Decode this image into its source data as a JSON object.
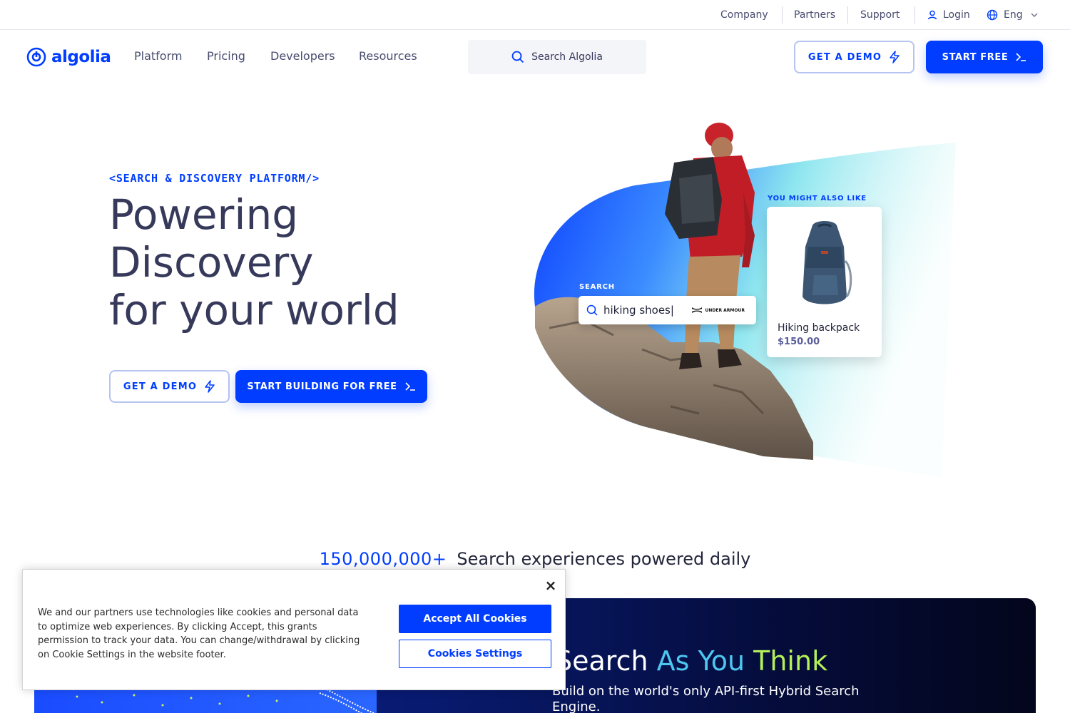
{
  "utility": {
    "company": "Company",
    "partners": "Partners",
    "support": "Support",
    "login": "Login",
    "language": "Eng"
  },
  "nav": {
    "logo": "algolia",
    "links": [
      "Platform",
      "Pricing",
      "Developers",
      "Resources"
    ],
    "search_placeholder": "Search Algolia",
    "demo_button": "GET A DEMO",
    "start_button": "START FREE"
  },
  "hero": {
    "eyebrow": "<SEARCH & DISCOVERY PLATFORM/>",
    "title_lines": [
      "Powering",
      "Discovery",
      "for your world"
    ],
    "demo_button": "GET A DEMO",
    "build_button": "START BUILDING FOR FREE"
  },
  "illustration": {
    "search_label": "SEARCH",
    "search_query": "hiking shoes|",
    "brand": "UNDER ARMOUR",
    "recommend_label": "YOU MIGHT ALSO LIKE",
    "product_name": "Hiking backpack",
    "product_price": "$150.00"
  },
  "stats": {
    "number": "150,000,000+",
    "text": "Search experiences powered daily"
  },
  "feature": {
    "title_prefix": "Search",
    "title_cyan": "As You",
    "title_green": "Think",
    "subtitle": "Build on the world's only API-first Hybrid Search Engine."
  },
  "cookie": {
    "text": "We and our partners use technologies like cookies and personal data to optimize web experiences. By clicking Accept, this grants permission to track your data. You can change/withdrawal by clicking on Cookie Settings in the website footer.",
    "close": "×",
    "accept": "Accept All Cookies",
    "settings": "Cookies Settings"
  },
  "colors": {
    "brand": "#003dff",
    "text_dark": "#36395a",
    "accent_cyan": "#4dc7f0",
    "accent_green": "#b4f05a"
  }
}
